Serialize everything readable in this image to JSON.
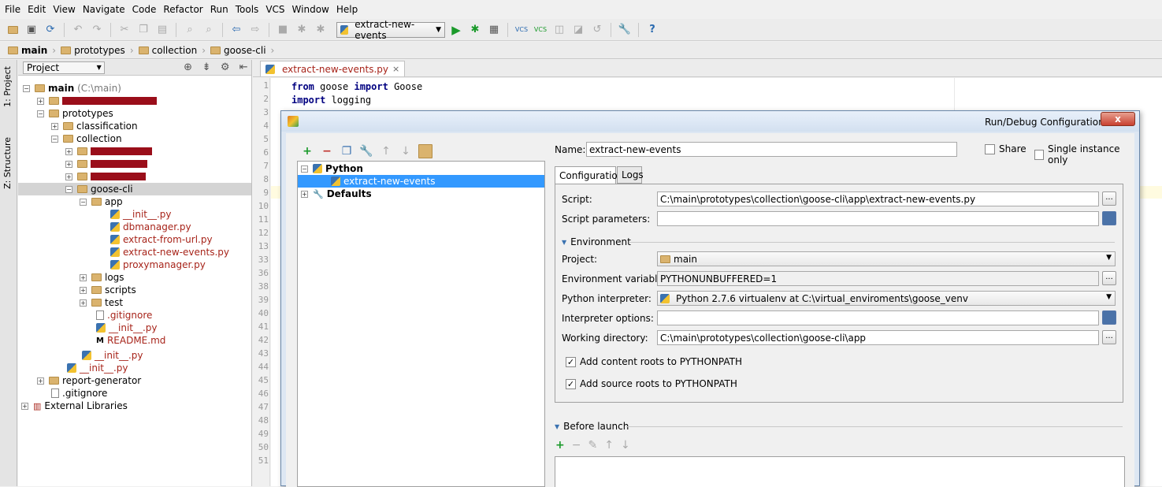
{
  "menu": [
    "File",
    "Edit",
    "View",
    "Navigate",
    "Code",
    "Refactor",
    "Run",
    "Tools",
    "VCS",
    "Window",
    "Help"
  ],
  "toolbar": {
    "run_config": "extract-new-events"
  },
  "breadcrumbs": [
    "main",
    "prototypes",
    "collection",
    "goose-cli"
  ],
  "side_tabs": {
    "project": "1: Project",
    "structure": "Z: Structure"
  },
  "project_panel": {
    "selector": "Project",
    "tree": [
      {
        "label": "main",
        "suffix": "(C:\\main)"
      },
      {
        "label": ""
      },
      {
        "label": "prototypes"
      },
      {
        "label": "classification"
      },
      {
        "label": "collection"
      },
      {
        "label": ""
      },
      {
        "label": ""
      },
      {
        "label": ""
      },
      {
        "label": "goose-cli"
      },
      {
        "label": "app"
      },
      {
        "label": "__init__.py"
      },
      {
        "label": "dbmanager.py"
      },
      {
        "label": "extract-from-url.py"
      },
      {
        "label": "extract-new-events.py"
      },
      {
        "label": "proxymanager.py"
      },
      {
        "label": "logs"
      },
      {
        "label": "scripts"
      },
      {
        "label": "test"
      },
      {
        "label": ".gitignore"
      },
      {
        "label": "__init__.py"
      },
      {
        "label": "README.md"
      },
      {
        "label": "__init__.py"
      },
      {
        "label": "__init__.py"
      },
      {
        "label": "report-generator"
      },
      {
        "label": ".gitignore"
      },
      {
        "label": "External Libraries"
      }
    ]
  },
  "editor": {
    "tab": "extract-new-events.py",
    "line_numbers": [
      "1",
      "2",
      "3",
      "4",
      "5",
      "6",
      "7",
      "8",
      "9",
      "10",
      "11",
      "12",
      "13",
      "33",
      "36",
      "38",
      "39",
      "40",
      "41",
      "42",
      "43",
      "44",
      "45",
      "46",
      "47",
      "48",
      "49",
      "50",
      "51"
    ],
    "code": {
      "l1_kw": "from",
      "l1_mid": " goose ",
      "l1_kw2": "import",
      "l1_end": " Goose",
      "l2_kw": "import",
      "l2_end": " logging"
    }
  },
  "dialog": {
    "title": "Run/Debug Configurations",
    "close": "x",
    "tree": {
      "python": "Python",
      "config": "extract-new-events",
      "defaults": "Defaults"
    },
    "name_label": "Name:",
    "name_value": "extract-new-events",
    "share": "Share",
    "single_instance": "Single instance only",
    "tabs": [
      "Configuration",
      "Logs"
    ],
    "script_label": "Script:",
    "script_value": "C:\\main\\prototypes\\collection\\goose-cli\\app\\extract-new-events.py",
    "script_params_label": "Script parameters:",
    "script_params_value": "",
    "environment": "Environment",
    "project_label": "Project:",
    "project_value": "main",
    "env_vars_label": "Environment variables:",
    "env_vars_value": "PYTHONUNBUFFERED=1",
    "interpreter_label": "Python interpreter:",
    "interpreter_value": "Python 2.7.6 virtualenv at C:\\virtual_enviroments\\goose_venv",
    "interp_options_label": "Interpreter options:",
    "interp_options_value": "",
    "workdir_label": "Working directory:",
    "workdir_value": "C:\\main\\prototypes\\collection\\goose-cli\\app",
    "content_roots": "Add content roots to PYTHONPATH",
    "source_roots": "Add source roots to PYTHONPATH",
    "before_launch": "Before launch",
    "browse": "..."
  }
}
